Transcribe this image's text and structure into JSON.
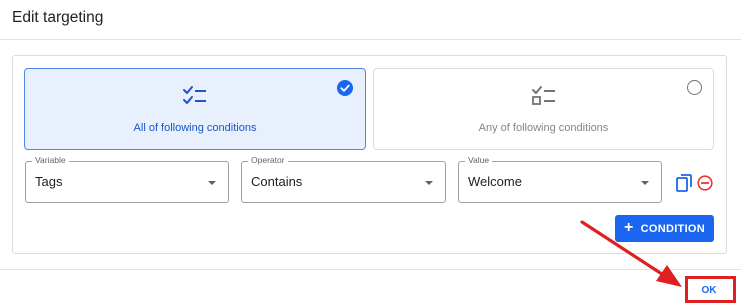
{
  "dialog": {
    "title": "Edit targeting"
  },
  "match_cards": {
    "all": {
      "label": "All of following conditions",
      "selected": true,
      "icon": "checklist-icon"
    },
    "any": {
      "label": "Any of following conditions",
      "selected": false,
      "icon": "checklist-icon"
    }
  },
  "condition": {
    "variable": {
      "label": "Variable",
      "value": "Tags"
    },
    "operator": {
      "label": "Operator",
      "value": "Contains"
    },
    "value": {
      "label": "Value",
      "value": "Welcome"
    }
  },
  "buttons": {
    "add_condition": "CONDITION",
    "ok": "OK"
  },
  "colors": {
    "primary": "#1a66f0",
    "selected_card_bg": "#e8f0fe",
    "remove": "#e53935",
    "annotation": "#e02020"
  }
}
